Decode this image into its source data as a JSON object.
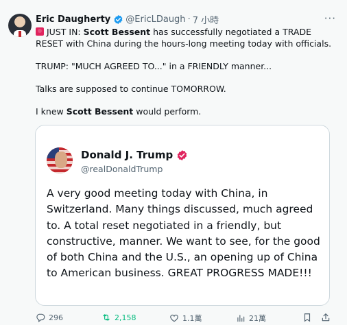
{
  "tweet": {
    "author_name": "Eric Daugherty",
    "author_handle": "@EricLDaugh",
    "separator": "·",
    "time": "7 小時",
    "more_label": "···",
    "lines": {
      "l1_prefix": "JUST IN: ",
      "l1_bold": "Scott Bessent",
      "l1_rest": " has successfully negotiated a TRADE RESET with China during the hours-long meeting today with officials.",
      "l2": "TRUMP: \"MUCH AGREED TO...\" in a FRIENDLY manner...",
      "l3": "Talks are supposed to continue TOMORROW.",
      "l4_prefix": "I knew ",
      "l4_bold": "Scott Bessent",
      "l4_rest": " would perform."
    }
  },
  "quoted": {
    "name": "Donald J. Trump",
    "handle": "@realDonaldTrump",
    "text": "A very good meeting today with China, in Switzerland. Many things discussed, much agreed to. A total reset negotiated in a friendly, but constructive, manner. We want to see, for the good of both China and the U.S., an opening up of China to American business. GREAT PROGRESS MADE!!!"
  },
  "actions": {
    "replies": "296",
    "retweets": "2,158",
    "likes": "1.1萬",
    "views": "21萬"
  },
  "colors": {
    "verified_blue": "#1d9bf0",
    "verified_pink": "#e0245e",
    "retweet_green": "#00ba7c",
    "muted": "#536471"
  },
  "icons": [
    "verified-badge-icon",
    "siren-emoji-icon",
    "reply-icon",
    "retweet-icon",
    "like-icon",
    "views-icon",
    "bookmark-icon",
    "share-icon",
    "more-icon"
  ]
}
